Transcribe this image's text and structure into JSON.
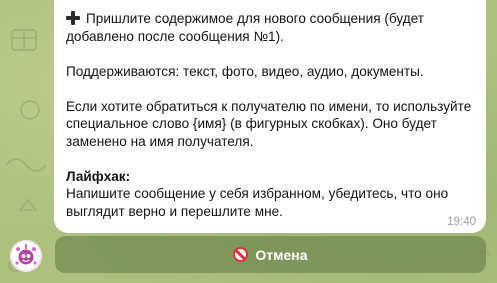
{
  "message": {
    "line1_text": "Пришлите содержимое для нового сообщения (будет",
    "line2_text": "добавлено после сообщения №1).",
    "line3_text": "Поддерживаются: текст, фото, видео, аудио, документы.",
    "line4_text": "Если хотите обратиться к получателю по имени, то используйте",
    "line5_text": "специальное слово {имя} (в фигурных скобках). Оно будет",
    "line6_text": "заменено на имя получателя.",
    "tip_title": "Лайфхак:",
    "tip_line1": "Напишите сообщение у себя избранном, убедитесь, что оно",
    "tip_line2": "выглядит верно и перешлите мне.",
    "time": "19:40",
    "leading_icon": "heavy-plus-icon"
  },
  "keyboard": {
    "cancel_label": "Отмена",
    "cancel_icon": "no-entry-icon"
  },
  "colors": {
    "cancel_icon": "#e0303a",
    "bubble": "#ffffff"
  }
}
